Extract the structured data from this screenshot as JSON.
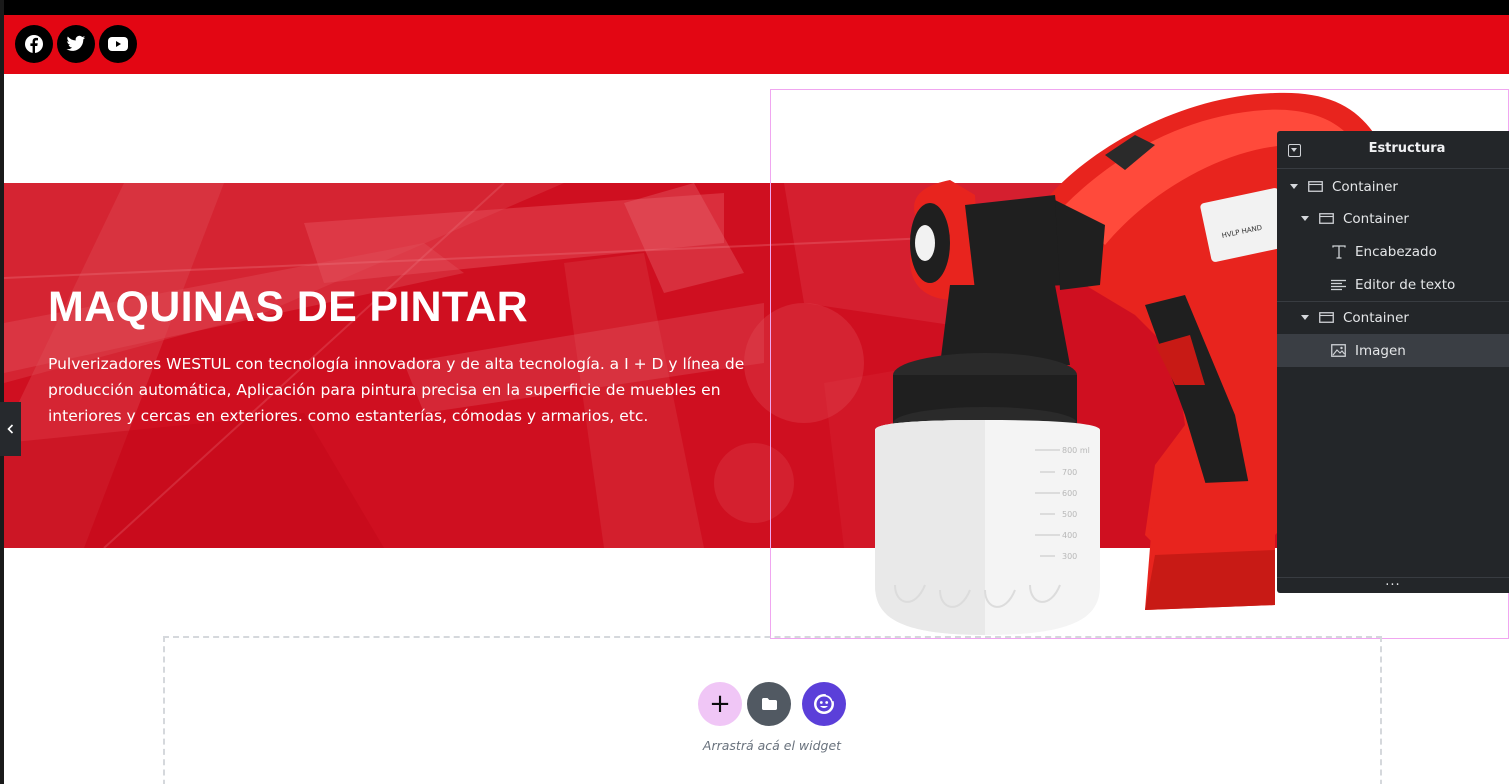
{
  "header": {
    "background": "#e30613",
    "social_icons": [
      "facebook-icon",
      "twitter-icon",
      "youtube-icon"
    ]
  },
  "hero": {
    "title": "MAQUINAS DE PINTAR",
    "description": "Pulverizadores WESTUL con tecnología innovadora y de alta tecnología. a I + D y línea de producción automática, Aplicación para pintura precisa en la superficie de muebles en interiores y cercas en exteriores. como estanterías, cómodas y armarios, etc.",
    "background": "#cc0b1c",
    "product_label": "HVLP HAND",
    "bottle_marks": [
      "800 ml",
      "700",
      "600",
      "500",
      "400",
      "300"
    ]
  },
  "structure_panel": {
    "title": "Estructura",
    "items": [
      {
        "label": "Container",
        "icon": "container-icon",
        "expanded": true,
        "selected": false
      },
      {
        "label": "Container",
        "icon": "container-icon",
        "expanded": true,
        "selected": false
      },
      {
        "label": "Encabezado",
        "icon": "heading-icon",
        "expanded": false,
        "selected": false
      },
      {
        "label": "Editor de texto",
        "icon": "text-editor-icon",
        "expanded": false,
        "selected": false
      },
      {
        "label": "Container",
        "icon": "container-icon",
        "expanded": true,
        "selected": false
      },
      {
        "label": "Imagen",
        "icon": "image-icon",
        "expanded": false,
        "selected": true
      }
    ],
    "footer": "..."
  },
  "drop_zone": {
    "add_label": "+",
    "hint": "Arrastrá acá el widget",
    "colors": {
      "add": "#f0c6f6",
      "folder": "#515962",
      "ai": "#5b3fd9"
    }
  }
}
